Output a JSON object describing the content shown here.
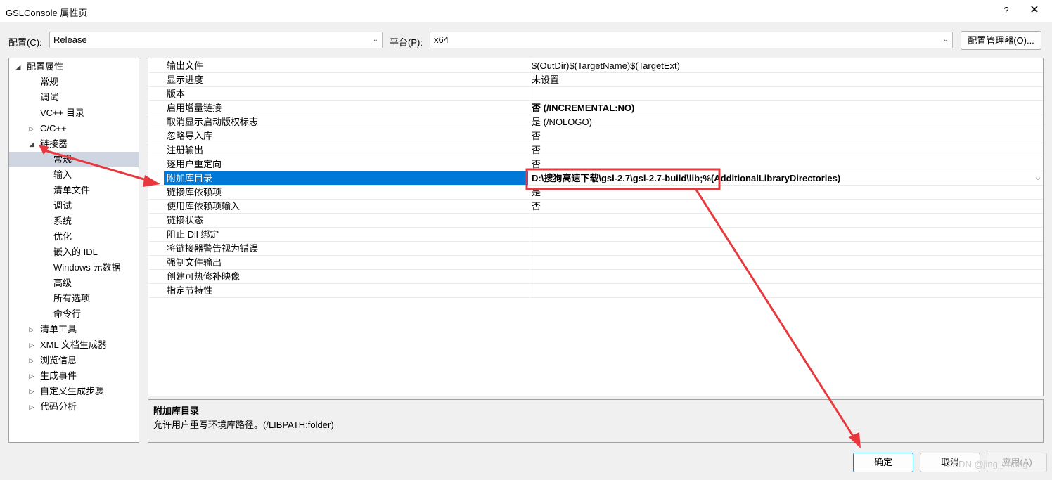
{
  "window": {
    "title": "GSLConsole 属性页",
    "help": "?",
    "close": "✕"
  },
  "config": {
    "label": "配置(C):",
    "value": "Release"
  },
  "platform": {
    "label": "平台(P):",
    "value": "x64"
  },
  "config_manager_label": "配置管理器(O)...",
  "tree": [
    {
      "label": "配置属性",
      "expander": "◢",
      "level": 0,
      "selected": false
    },
    {
      "label": "常规",
      "expander": "",
      "level": 1,
      "selected": false
    },
    {
      "label": "调试",
      "expander": "",
      "level": 1,
      "selected": false
    },
    {
      "label": "VC++ 目录",
      "expander": "",
      "level": 1,
      "selected": false
    },
    {
      "label": "C/C++",
      "expander": "▷",
      "level": 1,
      "selected": false
    },
    {
      "label": "链接器",
      "expander": "◢",
      "level": 1,
      "selected": false
    },
    {
      "label": "常规",
      "expander": "",
      "level": 2,
      "selected": true
    },
    {
      "label": "输入",
      "expander": "",
      "level": 2,
      "selected": false
    },
    {
      "label": "清单文件",
      "expander": "",
      "level": 2,
      "selected": false
    },
    {
      "label": "调试",
      "expander": "",
      "level": 2,
      "selected": false
    },
    {
      "label": "系统",
      "expander": "",
      "level": 2,
      "selected": false
    },
    {
      "label": "优化",
      "expander": "",
      "level": 2,
      "selected": false
    },
    {
      "label": "嵌入的 IDL",
      "expander": "",
      "level": 2,
      "selected": false
    },
    {
      "label": "Windows 元数据",
      "expander": "",
      "level": 2,
      "selected": false
    },
    {
      "label": "高级",
      "expander": "",
      "level": 2,
      "selected": false
    },
    {
      "label": "所有选项",
      "expander": "",
      "level": 2,
      "selected": false
    },
    {
      "label": "命令行",
      "expander": "",
      "level": 2,
      "selected": false
    },
    {
      "label": "清单工具",
      "expander": "▷",
      "level": 1,
      "selected": false
    },
    {
      "label": "XML 文档生成器",
      "expander": "▷",
      "level": 1,
      "selected": false
    },
    {
      "label": "浏览信息",
      "expander": "▷",
      "level": 1,
      "selected": false
    },
    {
      "label": "生成事件",
      "expander": "▷",
      "level": 1,
      "selected": false
    },
    {
      "label": "自定义生成步骤",
      "expander": "▷",
      "level": 1,
      "selected": false
    },
    {
      "label": "代码分析",
      "expander": "▷",
      "level": 1,
      "selected": false
    }
  ],
  "properties": [
    {
      "name": "输出文件",
      "value": "$(OutDir)$(TargetName)$(TargetExt)",
      "bold": false,
      "selected": false
    },
    {
      "name": "显示进度",
      "value": "未设置",
      "bold": false,
      "selected": false
    },
    {
      "name": "版本",
      "value": "",
      "bold": false,
      "selected": false
    },
    {
      "name": "启用增量链接",
      "value": "否 (/INCREMENTAL:NO)",
      "bold": true,
      "selected": false
    },
    {
      "name": "取消显示启动版权标志",
      "value": "是 (/NOLOGO)",
      "bold": false,
      "selected": false
    },
    {
      "name": "忽略导入库",
      "value": "否",
      "bold": false,
      "selected": false
    },
    {
      "name": "注册输出",
      "value": "否",
      "bold": false,
      "selected": false
    },
    {
      "name": "逐用户重定向",
      "value": "否",
      "bold": false,
      "selected": false
    },
    {
      "name": "附加库目录",
      "value": "D:\\搜狗高速下载\\gsl-2.7\\gsl-2.7-build\\lib;%(AdditionalLibraryDirectories)",
      "bold": true,
      "selected": true
    },
    {
      "name": "链接库依赖项",
      "value": "是",
      "bold": false,
      "selected": false
    },
    {
      "name": "使用库依赖项输入",
      "value": "否",
      "bold": false,
      "selected": false
    },
    {
      "name": "链接状态",
      "value": "",
      "bold": false,
      "selected": false
    },
    {
      "name": "阻止 Dll 绑定",
      "value": "",
      "bold": false,
      "selected": false
    },
    {
      "name": "将链接器警告视为错误",
      "value": "",
      "bold": false,
      "selected": false
    },
    {
      "name": "强制文件输出",
      "value": "",
      "bold": false,
      "selected": false
    },
    {
      "name": "创建可热修补映像",
      "value": "",
      "bold": false,
      "selected": false
    },
    {
      "name": "指定节特性",
      "value": "",
      "bold": false,
      "selected": false
    }
  ],
  "description": {
    "title": "附加库目录",
    "text": "允许用户重写环境库路径。(/LIBPATH:folder)"
  },
  "buttons": {
    "ok": "确定",
    "cancel": "取消",
    "apply": "应用(A)"
  },
  "watermark": "CSDN @jing_zhong",
  "colors": {
    "selection": "#0078d7",
    "annotation": "#e8383d",
    "tree_selection": "#cfd6e2"
  }
}
